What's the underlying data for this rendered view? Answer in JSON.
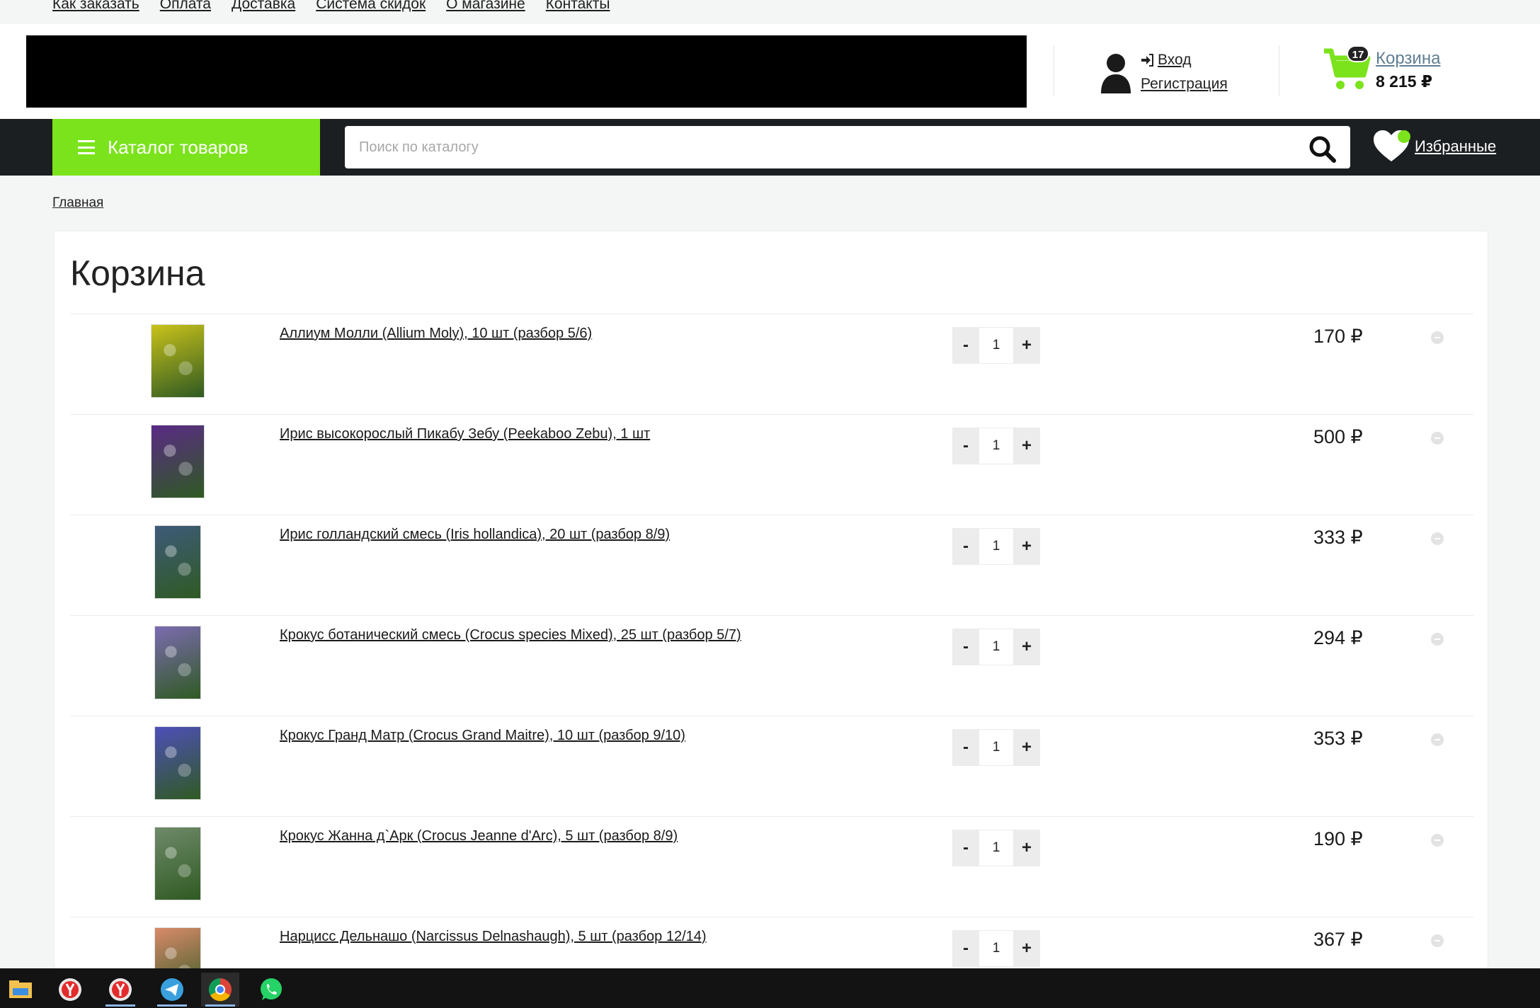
{
  "topnav": {
    "links": [
      "Как заказать",
      "Оплата",
      "Доставка",
      "Система скидок",
      "О магазине",
      "Контакты"
    ]
  },
  "header": {
    "login_label": "Вход",
    "register_label": "Регистрация",
    "cart_badge": "17",
    "cart_label": "Корзина",
    "cart_total": "8 215 ₽"
  },
  "navbar": {
    "catalog_label": "Каталог товаров",
    "search_placeholder": "Поиск по каталогу",
    "favorites_label": "Избранные"
  },
  "breadcrumb": {
    "home": "Главная"
  },
  "cart": {
    "title": "Корзина",
    "items": [
      {
        "name": "Аллиум Молли (Allium Moly), 10 шт (разбор 5/6)",
        "qty": "1",
        "price": "170 ₽",
        "thumb_color": "#c9c21a"
      },
      {
        "name": "Ирис высокорослый Пикабу Зебу (Peekaboo Zebu), 1 шт",
        "qty": "1",
        "price": "500 ₽",
        "thumb_color": "#5a2a86"
      },
      {
        "name": "Ирис голландский смесь (Iris hollandica), 20 шт (разбор 8/9)",
        "qty": "1",
        "price": "333 ₽",
        "thumb_color": "#3e5a7a"
      },
      {
        "name": "Крокус ботанический смесь (Crocus species Mixed), 25 шт (разбор 5/7)",
        "qty": "1",
        "price": "294 ₽",
        "thumb_color": "#7c6bb0"
      },
      {
        "name": "Крокус Гранд Матр (Crocus Grand Maitre), 10 шт (разбор 9/10)",
        "qty": "1",
        "price": "353 ₽",
        "thumb_color": "#4e4fb8"
      },
      {
        "name": "Крокус Жанна д`Арк (Crocus Jeanne d'Arc), 5 шт (разбор 8/9)",
        "qty": "1",
        "price": "190 ₽",
        "thumb_color": "#6f8a6a"
      },
      {
        "name": "Нарцисс Дельнашо (Narcissus Delnashaugh), 5 шт (разбор 12/14)",
        "qty": "1",
        "price": "367 ₽",
        "thumb_color": "#d98a6a"
      }
    ],
    "minus_label": "-",
    "plus_label": "+"
  },
  "colors": {
    "accent_green": "#7be31c",
    "dark_bar": "#1c1f21"
  },
  "taskbar": {
    "icons": [
      "file-explorer-icon",
      "yandex-browser-icon",
      "yandex-browser-icon",
      "telegram-icon",
      "chrome-icon",
      "whatsapp-icon"
    ]
  }
}
